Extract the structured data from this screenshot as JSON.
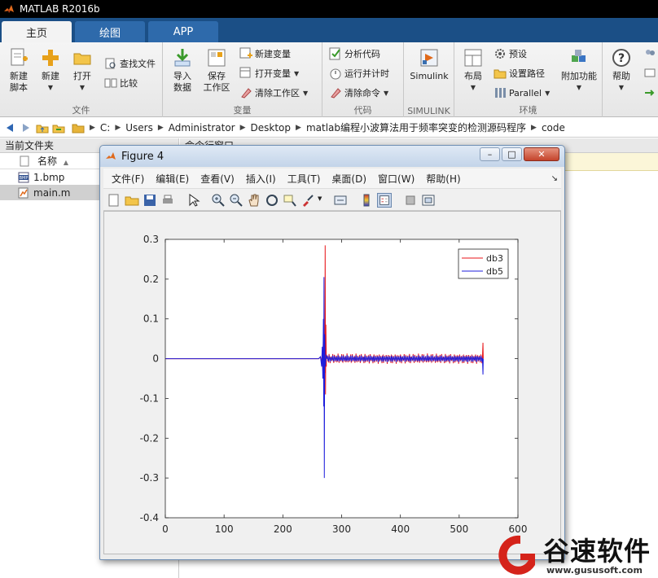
{
  "app": {
    "title": "MATLAB R2016b"
  },
  "tabs": [
    {
      "label": "主页",
      "active": true
    },
    {
      "label": "绘图",
      "active": false
    },
    {
      "label": "APP",
      "active": false
    }
  ],
  "ribbon": {
    "file": {
      "label": "文件",
      "new_script": "新建\n脚本",
      "new": "新建",
      "open": "打开",
      "find_files": "查找文件",
      "compare": "比较"
    },
    "variable": {
      "label": "变量",
      "import": "导入\n数据",
      "save_ws": "保存\n工作区",
      "new_var": "新建变量",
      "open_var": "打开变量",
      "clear_ws": "清除工作区"
    },
    "code": {
      "label": "代码",
      "analyze": "分析代码",
      "run_time": "运行并计时",
      "clear_cmd": "清除命令"
    },
    "simulink": {
      "label": "SIMULINK",
      "button": "Simulink"
    },
    "env": {
      "label": "环境",
      "layout": "布局",
      "prefs": "预设",
      "set_path": "设置路径",
      "parallel": "Parallel",
      "addons": "附加功能"
    },
    "help": {
      "label": "帮助"
    }
  },
  "address": {
    "crumbs": [
      "C:",
      "Users",
      "Administrator",
      "Desktop",
      "matlab编程小波算法用于频率突变的检测源码程序",
      "code"
    ]
  },
  "left_panel": {
    "title": "当前文件夹",
    "column": "名称",
    "files": [
      {
        "name": "1.bmp",
        "type": "bmp",
        "selected": false
      },
      {
        "name": "main.m",
        "type": "m",
        "selected": true
      }
    ]
  },
  "command_window": {
    "title": "命令行窗口"
  },
  "figure": {
    "title": "Figure 4",
    "menu": [
      "文件(F)",
      "编辑(E)",
      "查看(V)",
      "插入(I)",
      "工具(T)",
      "桌面(D)",
      "窗口(W)",
      "帮助(H)"
    ],
    "window_buttons": {
      "minimize": "–",
      "restore": "□",
      "close": "✕"
    }
  },
  "chart_data": {
    "type": "line",
    "x": {
      "min": 0,
      "max": 600,
      "ticks": [
        0,
        100,
        200,
        300,
        400,
        500,
        600
      ]
    },
    "y": {
      "min": -0.4,
      "max": 0.3,
      "ticks": [
        0.3,
        0.2,
        0.1,
        0,
        -0.1,
        -0.2,
        -0.3,
        -0.4
      ]
    },
    "tick_labels_x": [
      "0",
      "100",
      "200",
      "300",
      "400",
      "500",
      "600"
    ],
    "tick_labels_y": [
      "0.3",
      "0.2",
      "0.1",
      "0",
      "-0.1",
      "-0.2",
      "-0.3",
      "-0.4"
    ],
    "legend": {
      "placement": "top-right"
    },
    "series": [
      {
        "name": "db3",
        "color": "#e8161a",
        "features": {
          "flat_until": 263,
          "spike_x": 272,
          "spike_max": 0.285,
          "spike_min": -0.09,
          "oscillation_start": 275,
          "oscillation_end": 540,
          "oscillation_amp": 0.013,
          "oscillation_period": 7.6,
          "end_spike": 0.04
        }
      },
      {
        "name": "db5",
        "color": "#1e1edc",
        "features": {
          "flat_until": 263,
          "spike_x": 270,
          "spike_max": 0.205,
          "spike_min": -0.3,
          "oscillation_start": 275,
          "oscillation_end": 540,
          "oscillation_amp": 0.009,
          "oscillation_period": 7.6,
          "end_spike": -0.04
        }
      }
    ]
  },
  "watermark": {
    "text": "谷速软件",
    "url": "www.gususoft.com",
    "accent": "#d5231a"
  }
}
